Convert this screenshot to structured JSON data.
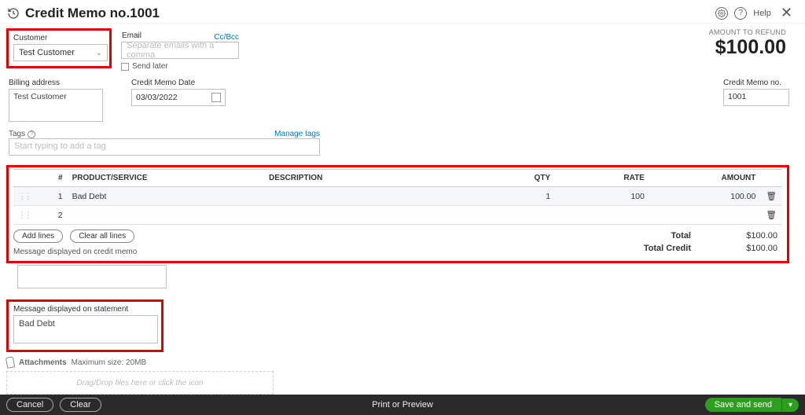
{
  "header": {
    "title": "Credit Memo no.1001",
    "help_label": "Help"
  },
  "customer": {
    "label": "Customer",
    "value": "Test Customer"
  },
  "email": {
    "label": "Email",
    "placeholder": "Separate emails with a comma",
    "ccbcc": "Cc/Bcc",
    "send_later": "Send later"
  },
  "amount": {
    "label": "AMOUNT TO REFUND",
    "value": "$100.00"
  },
  "billing": {
    "label": "Billing address",
    "value": "Test Customer"
  },
  "date": {
    "label": "Credit Memo Date",
    "value": "03/03/2022"
  },
  "docno": {
    "label": "Credit Memo no.",
    "value": "1001"
  },
  "tags": {
    "label": "Tags",
    "placeholder": "Start typing to add a tag",
    "manage": "Manage tags"
  },
  "columns": {
    "num": "#",
    "product": "PRODUCT/SERVICE",
    "description": "DESCRIPTION",
    "qty": "QTY",
    "rate": "RATE",
    "amount": "AMOUNT"
  },
  "lines": [
    {
      "num": "1",
      "product": "Bad Debt",
      "description": "",
      "qty": "1",
      "rate": "100",
      "amount": "100.00"
    },
    {
      "num": "2",
      "product": "",
      "description": "",
      "qty": "",
      "rate": "",
      "amount": ""
    }
  ],
  "line_actions": {
    "add": "Add lines",
    "clear": "Clear all lines"
  },
  "totals": {
    "total_label": "Total",
    "total_value": "$100.00",
    "credit_label": "Total Credit",
    "credit_value": "$100.00"
  },
  "memo_msg": {
    "label": "Message displayed on credit memo"
  },
  "stmt_msg": {
    "label": "Message displayed on statement",
    "value": "Bad Debt"
  },
  "attachments": {
    "label": "Attachments",
    "hint": "Maximum size: 20MB",
    "dropzone": "Drag/Drop files here or click the icon"
  },
  "footer": {
    "cancel": "Cancel",
    "clear": "Clear",
    "print": "Print or Preview",
    "save": "Save and send"
  }
}
